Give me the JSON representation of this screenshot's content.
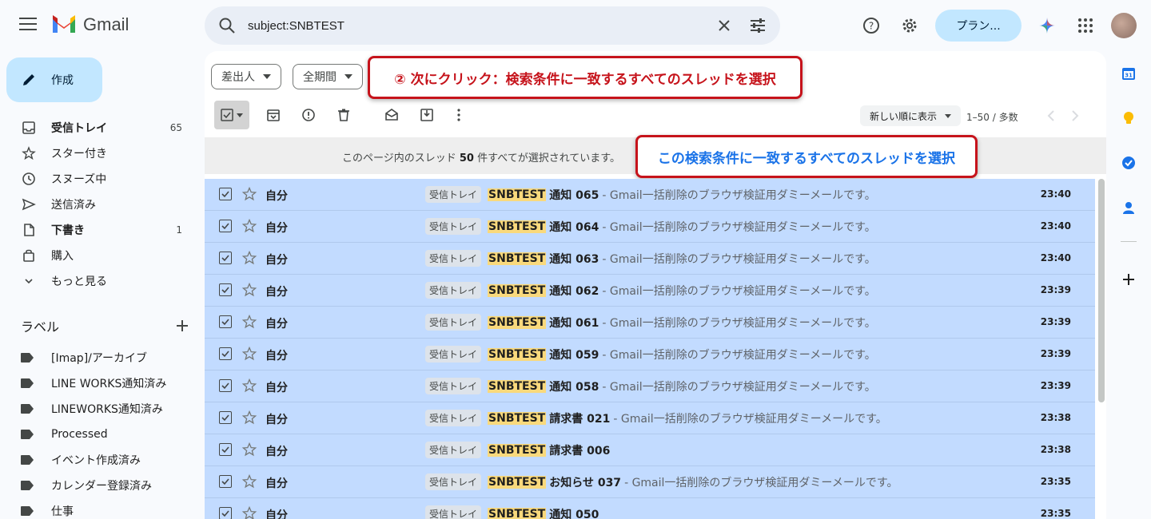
{
  "app": {
    "name": "Gmail"
  },
  "search": {
    "value": "subject:SNBTEST"
  },
  "header": {
    "plan_label": "プラン..."
  },
  "compose": {
    "label": "作成"
  },
  "nav": {
    "items": [
      {
        "label": "受信トレイ",
        "count": "65",
        "bold": true,
        "icon": "inbox-icon"
      },
      {
        "label": "スター付き",
        "count": "",
        "bold": false,
        "icon": "star-icon"
      },
      {
        "label": "スヌーズ中",
        "count": "",
        "bold": false,
        "icon": "clock-icon"
      },
      {
        "label": "送信済み",
        "count": "",
        "bold": false,
        "icon": "send-icon"
      },
      {
        "label": "下書き",
        "count": "1",
        "bold": true,
        "icon": "draft-icon"
      },
      {
        "label": "購入",
        "count": "",
        "bold": false,
        "icon": "shopping-bag-icon"
      },
      {
        "label": "もっと見る",
        "count": "",
        "bold": false,
        "icon": "chevron-down-icon"
      }
    ]
  },
  "labels": {
    "title": "ラベル",
    "items": [
      {
        "label": "[Imap]/アーカイブ"
      },
      {
        "label": "LINE WORKS通知済み"
      },
      {
        "label": "LINEWORKS通知済み"
      },
      {
        "label": "Processed"
      },
      {
        "label": "イベント作成済み"
      },
      {
        "label": "カレンダー登録済み"
      },
      {
        "label": "仕事"
      }
    ]
  },
  "filters": {
    "sender": "差出人",
    "period": "全期間"
  },
  "callouts": {
    "step2": "② 次にクリック：検索条件に一致するすべてのスレッドを選択",
    "select_all_link": "この検索条件に一致するすべてのスレッドを選択"
  },
  "toolbar": {
    "sort_label": "新しい順に表示",
    "page_range": "1–50 / 多数"
  },
  "banner": {
    "prefix": "このページ内のスレッド",
    "count": "50",
    "suffix": "件すべてが選択されています。"
  },
  "emails": [
    {
      "sender": "自分",
      "chip": "受信トレイ",
      "highlight": "SNBTEST",
      "subject": "通知 065",
      "snippet": "- Gmail一括削除のブラウザ検証用ダミーメールです。",
      "time": "23:40"
    },
    {
      "sender": "自分",
      "chip": "受信トレイ",
      "highlight": "SNBTEST",
      "subject": "通知 064",
      "snippet": "- Gmail一括削除のブラウザ検証用ダミーメールです。",
      "time": "23:40"
    },
    {
      "sender": "自分",
      "chip": "受信トレイ",
      "highlight": "SNBTEST",
      "subject": "通知 063",
      "snippet": "- Gmail一括削除のブラウザ検証用ダミーメールです。",
      "time": "23:40"
    },
    {
      "sender": "自分",
      "chip": "受信トレイ",
      "highlight": "SNBTEST",
      "subject": "通知 062",
      "snippet": "- Gmail一括削除のブラウザ検証用ダミーメールです。",
      "time": "23:39"
    },
    {
      "sender": "自分",
      "chip": "受信トレイ",
      "highlight": "SNBTEST",
      "subject": "通知 061",
      "snippet": "- Gmail一括削除のブラウザ検証用ダミーメールです。",
      "time": "23:39"
    },
    {
      "sender": "自分",
      "chip": "受信トレイ",
      "highlight": "SNBTEST",
      "subject": "通知 059",
      "snippet": "- Gmail一括削除のブラウザ検証用ダミーメールです。",
      "time": "23:39"
    },
    {
      "sender": "自分",
      "chip": "受信トレイ",
      "highlight": "SNBTEST",
      "subject": "通知 058",
      "snippet": "- Gmail一括削除のブラウザ検証用ダミーメールです。",
      "time": "23:39"
    },
    {
      "sender": "自分",
      "chip": "受信トレイ",
      "highlight": "SNBTEST",
      "subject": "請求書 021",
      "snippet": "- Gmail一括削除のブラウザ検証用ダミーメールです。",
      "time": "23:38"
    },
    {
      "sender": "自分",
      "chip": "受信トレイ",
      "highlight": "SNBTEST",
      "subject": "請求書 006",
      "snippet": "",
      "time": "23:38"
    },
    {
      "sender": "自分",
      "chip": "受信トレイ",
      "highlight": "SNBTEST",
      "subject": "お知らせ 037",
      "snippet": "- Gmail一括削除のブラウザ検証用ダミーメールです。",
      "time": "23:35"
    },
    {
      "sender": "自分",
      "chip": "受信トレイ",
      "highlight": "SNBTEST",
      "subject": "通知 050",
      "snippet": "",
      "time": "23:35"
    }
  ],
  "colors": {
    "selected_row": "#c2dbff",
    "compose_bg": "#c2e7ff",
    "callout_border": "#c6131b",
    "link_blue": "#1a73e8",
    "highlight": "#f9d97c"
  }
}
